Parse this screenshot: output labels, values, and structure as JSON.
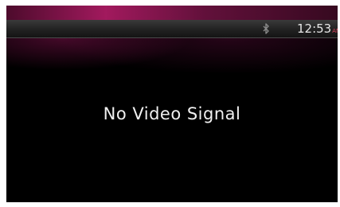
{
  "status_bar": {
    "icon": "bluetooth-icon",
    "time": "12:53",
    "ampm": "AM"
  },
  "main": {
    "message": "No Video Signal"
  },
  "colors": {
    "accent": "#c21f6e",
    "ampm": "#d8425a",
    "background": "#000000",
    "text": "#f0f0f0"
  }
}
